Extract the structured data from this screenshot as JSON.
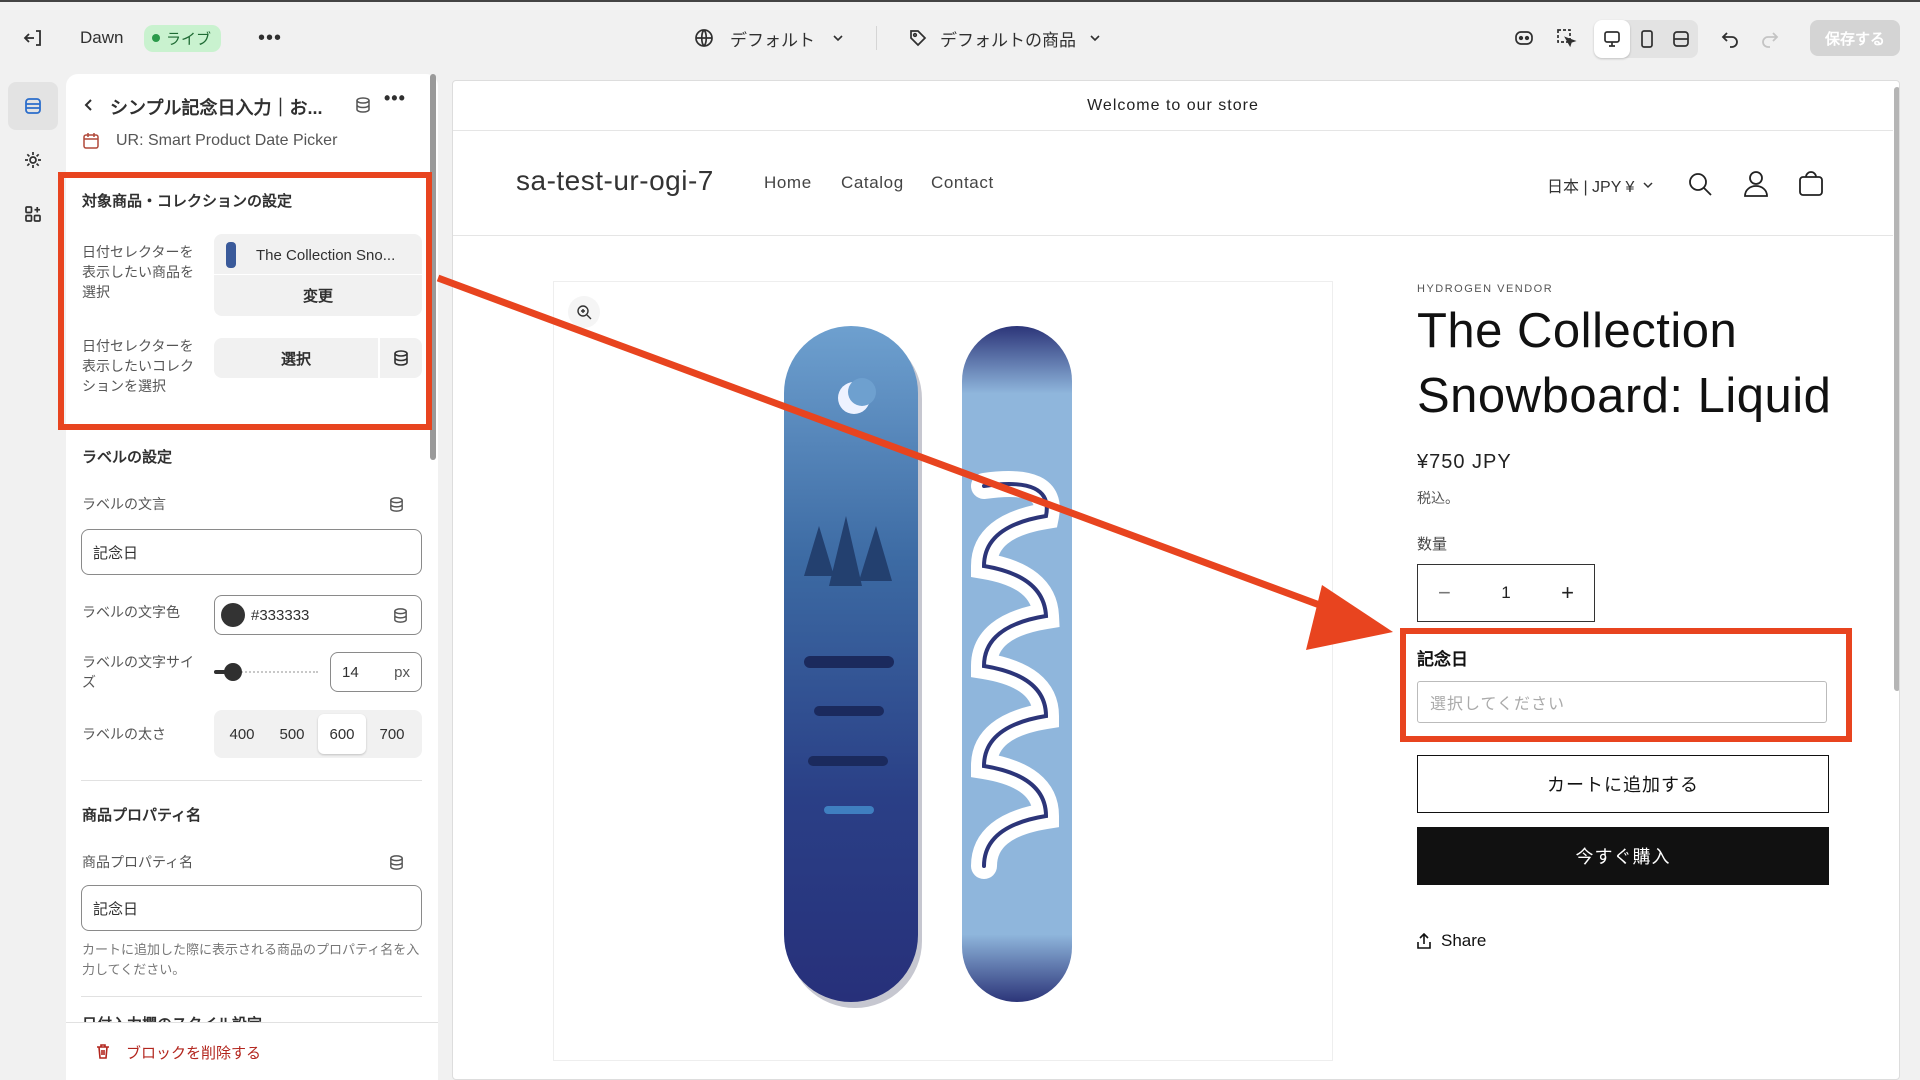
{
  "topbar": {
    "theme_name": "Dawn",
    "live_label": "ライブ",
    "context_label": "デフォルト",
    "template_label": "デフォルトの商品",
    "save_label": "保存する"
  },
  "panel": {
    "block_title": "シンプル記念日入力｜お...",
    "app_name": "UR: Smart Product Date Picker",
    "target_section": {
      "heading": "対象商品・コレクションの設定",
      "product_label": "日付セレクターを表示したい商品を選択",
      "product_value": "The Collection Sno...",
      "change_label": "変更",
      "collection_label": "日付セレクターを表示したいコレクションを選択",
      "select_label": "選択"
    },
    "label_section": {
      "heading": "ラベルの設定",
      "text_label": "ラベルの文言",
      "text_value": "記念日",
      "color_label": "ラベルの文字色",
      "color_value": "#333333",
      "size_label": "ラベルの文字サイズ",
      "size_value": "14",
      "size_unit": "px",
      "size_slider_level": 0.1,
      "weight_label": "ラベルの太さ",
      "weights": [
        "400",
        "500",
        "600",
        "700"
      ],
      "weight_selected": "600"
    },
    "property_section": {
      "heading": "商品プロパティ名",
      "field_label": "商品プロパティ名",
      "field_value": "記念日",
      "help": "カートに追加した際に表示される商品のプロパティ名を入力してください。",
      "next_heading": "日付入力欄のスタイル設定"
    },
    "delete_label": "ブロックを削除する"
  },
  "store": {
    "announcement": "Welcome to our store",
    "brand": "sa-test-ur-ogi-7",
    "nav": [
      "Home",
      "Catalog",
      "Contact"
    ],
    "locale": "日本 | JPY ¥",
    "vendor": "HYDROGEN VENDOR",
    "title": "The Collection Snowboard: Liquid",
    "price": "¥750 JPY",
    "tax_note": "税込。",
    "qty_label": "数量",
    "qty_value": "1",
    "date_label": "記念日",
    "date_placeholder": "選択してください",
    "add_to_cart": "カートに追加する",
    "buy_now": "今すぐ購入",
    "share": "Share"
  },
  "colors": {
    "annotation": "#e8441f",
    "label_color": "#333333",
    "live_badge": "#c9f2cf"
  }
}
